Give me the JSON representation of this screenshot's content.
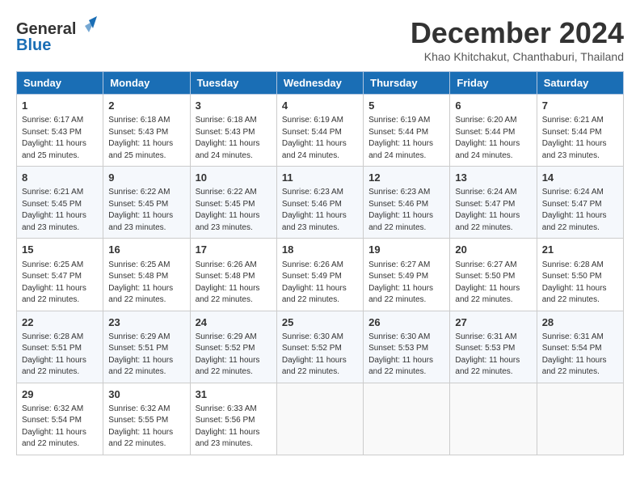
{
  "header": {
    "logo": {
      "line1_general": "General",
      "line1_blue": "Blue",
      "tagline": "Blue"
    },
    "title": "December 2024",
    "location": "Khao Khitchakut, Chanthaburi, Thailand"
  },
  "calendar": {
    "headers": [
      "Sunday",
      "Monday",
      "Tuesday",
      "Wednesday",
      "Thursday",
      "Friday",
      "Saturday"
    ],
    "weeks": [
      [
        {
          "day": "",
          "info": ""
        },
        {
          "day": "2",
          "info": "Sunrise: 6:18 AM\nSunset: 5:43 PM\nDaylight: 11 hours\nand 25 minutes."
        },
        {
          "day": "3",
          "info": "Sunrise: 6:18 AM\nSunset: 5:43 PM\nDaylight: 11 hours\nand 24 minutes."
        },
        {
          "day": "4",
          "info": "Sunrise: 6:19 AM\nSunset: 5:44 PM\nDaylight: 11 hours\nand 24 minutes."
        },
        {
          "day": "5",
          "info": "Sunrise: 6:19 AM\nSunset: 5:44 PM\nDaylight: 11 hours\nand 24 minutes."
        },
        {
          "day": "6",
          "info": "Sunrise: 6:20 AM\nSunset: 5:44 PM\nDaylight: 11 hours\nand 24 minutes."
        },
        {
          "day": "7",
          "info": "Sunrise: 6:21 AM\nSunset: 5:44 PM\nDaylight: 11 hours\nand 23 minutes."
        }
      ],
      [
        {
          "day": "1",
          "info": "Sunrise: 6:17 AM\nSunset: 5:43 PM\nDaylight: 11 hours\nand 25 minutes.",
          "is_first": true
        },
        {
          "day": "8",
          "info": ""
        },
        {
          "day": "9",
          "info": ""
        },
        {
          "day": "10",
          "info": ""
        },
        {
          "day": "11",
          "info": ""
        },
        {
          "day": "12",
          "info": ""
        },
        {
          "day": "13",
          "info": ""
        }
      ],
      [
        {
          "day": "8",
          "info": "Sunrise: 6:21 AM\nSunset: 5:45 PM\nDaylight: 11 hours\nand 23 minutes."
        },
        {
          "day": "9",
          "info": "Sunrise: 6:22 AM\nSunset: 5:45 PM\nDaylight: 11 hours\nand 23 minutes."
        },
        {
          "day": "10",
          "info": "Sunrise: 6:22 AM\nSunset: 5:45 PM\nDaylight: 11 hours\nand 23 minutes."
        },
        {
          "day": "11",
          "info": "Sunrise: 6:23 AM\nSunset: 5:46 PM\nDaylight: 11 hours\nand 23 minutes."
        },
        {
          "day": "12",
          "info": "Sunrise: 6:23 AM\nSunset: 5:46 PM\nDaylight: 11 hours\nand 22 minutes."
        },
        {
          "day": "13",
          "info": "Sunrise: 6:24 AM\nSunset: 5:47 PM\nDaylight: 11 hours\nand 22 minutes."
        },
        {
          "day": "14",
          "info": "Sunrise: 6:24 AM\nSunset: 5:47 PM\nDaylight: 11 hours\nand 22 minutes."
        }
      ],
      [
        {
          "day": "15",
          "info": "Sunrise: 6:25 AM\nSunset: 5:47 PM\nDaylight: 11 hours\nand 22 minutes."
        },
        {
          "day": "16",
          "info": "Sunrise: 6:25 AM\nSunset: 5:48 PM\nDaylight: 11 hours\nand 22 minutes."
        },
        {
          "day": "17",
          "info": "Sunrise: 6:26 AM\nSunset: 5:48 PM\nDaylight: 11 hours\nand 22 minutes."
        },
        {
          "day": "18",
          "info": "Sunrise: 6:26 AM\nSunset: 5:49 PM\nDaylight: 11 hours\nand 22 minutes."
        },
        {
          "day": "19",
          "info": "Sunrise: 6:27 AM\nSunset: 5:49 PM\nDaylight: 11 hours\nand 22 minutes."
        },
        {
          "day": "20",
          "info": "Sunrise: 6:27 AM\nSunset: 5:50 PM\nDaylight: 11 hours\nand 22 minutes."
        },
        {
          "day": "21",
          "info": "Sunrise: 6:28 AM\nSunset: 5:50 PM\nDaylight: 11 hours\nand 22 minutes."
        }
      ],
      [
        {
          "day": "22",
          "info": "Sunrise: 6:28 AM\nSunset: 5:51 PM\nDaylight: 11 hours\nand 22 minutes."
        },
        {
          "day": "23",
          "info": "Sunrise: 6:29 AM\nSunset: 5:51 PM\nDaylight: 11 hours\nand 22 minutes."
        },
        {
          "day": "24",
          "info": "Sunrise: 6:29 AM\nSunset: 5:52 PM\nDaylight: 11 hours\nand 22 minutes."
        },
        {
          "day": "25",
          "info": "Sunrise: 6:30 AM\nSunset: 5:52 PM\nDaylight: 11 hours\nand 22 minutes."
        },
        {
          "day": "26",
          "info": "Sunrise: 6:30 AM\nSunset: 5:53 PM\nDaylight: 11 hours\nand 22 minutes."
        },
        {
          "day": "27",
          "info": "Sunrise: 6:31 AM\nSunset: 5:53 PM\nDaylight: 11 hours\nand 22 minutes."
        },
        {
          "day": "28",
          "info": "Sunrise: 6:31 AM\nSunset: 5:54 PM\nDaylight: 11 hours\nand 22 minutes."
        }
      ],
      [
        {
          "day": "29",
          "info": "Sunrise: 6:32 AM\nSunset: 5:54 PM\nDaylight: 11 hours\nand 22 minutes."
        },
        {
          "day": "30",
          "info": "Sunrise: 6:32 AM\nSunset: 5:55 PM\nDaylight: 11 hours\nand 22 minutes."
        },
        {
          "day": "31",
          "info": "Sunrise: 6:33 AM\nSunset: 5:56 PM\nDaylight: 11 hours\nand 23 minutes."
        },
        {
          "day": "",
          "info": ""
        },
        {
          "day": "",
          "info": ""
        },
        {
          "day": "",
          "info": ""
        },
        {
          "day": "",
          "info": ""
        }
      ]
    ],
    "week1": [
      {
        "day": "1",
        "info": "Sunrise: 6:17 AM\nSunset: 5:43 PM\nDaylight: 11 hours\nand 25 minutes."
      },
      {
        "day": "2",
        "info": "Sunrise: 6:18 AM\nSunset: 5:43 PM\nDaylight: 11 hours\nand 25 minutes."
      },
      {
        "day": "3",
        "info": "Sunrise: 6:18 AM\nSunset: 5:43 PM\nDaylight: 11 hours\nand 24 minutes."
      },
      {
        "day": "4",
        "info": "Sunrise: 6:19 AM\nSunset: 5:44 PM\nDaylight: 11 hours\nand 24 minutes."
      },
      {
        "day": "5",
        "info": "Sunrise: 6:19 AM\nSunset: 5:44 PM\nDaylight: 11 hours\nand 24 minutes."
      },
      {
        "day": "6",
        "info": "Sunrise: 6:20 AM\nSunset: 5:44 PM\nDaylight: 11 hours\nand 24 minutes."
      },
      {
        "day": "7",
        "info": "Sunrise: 6:21 AM\nSunset: 5:44 PM\nDaylight: 11 hours\nand 23 minutes."
      }
    ]
  }
}
